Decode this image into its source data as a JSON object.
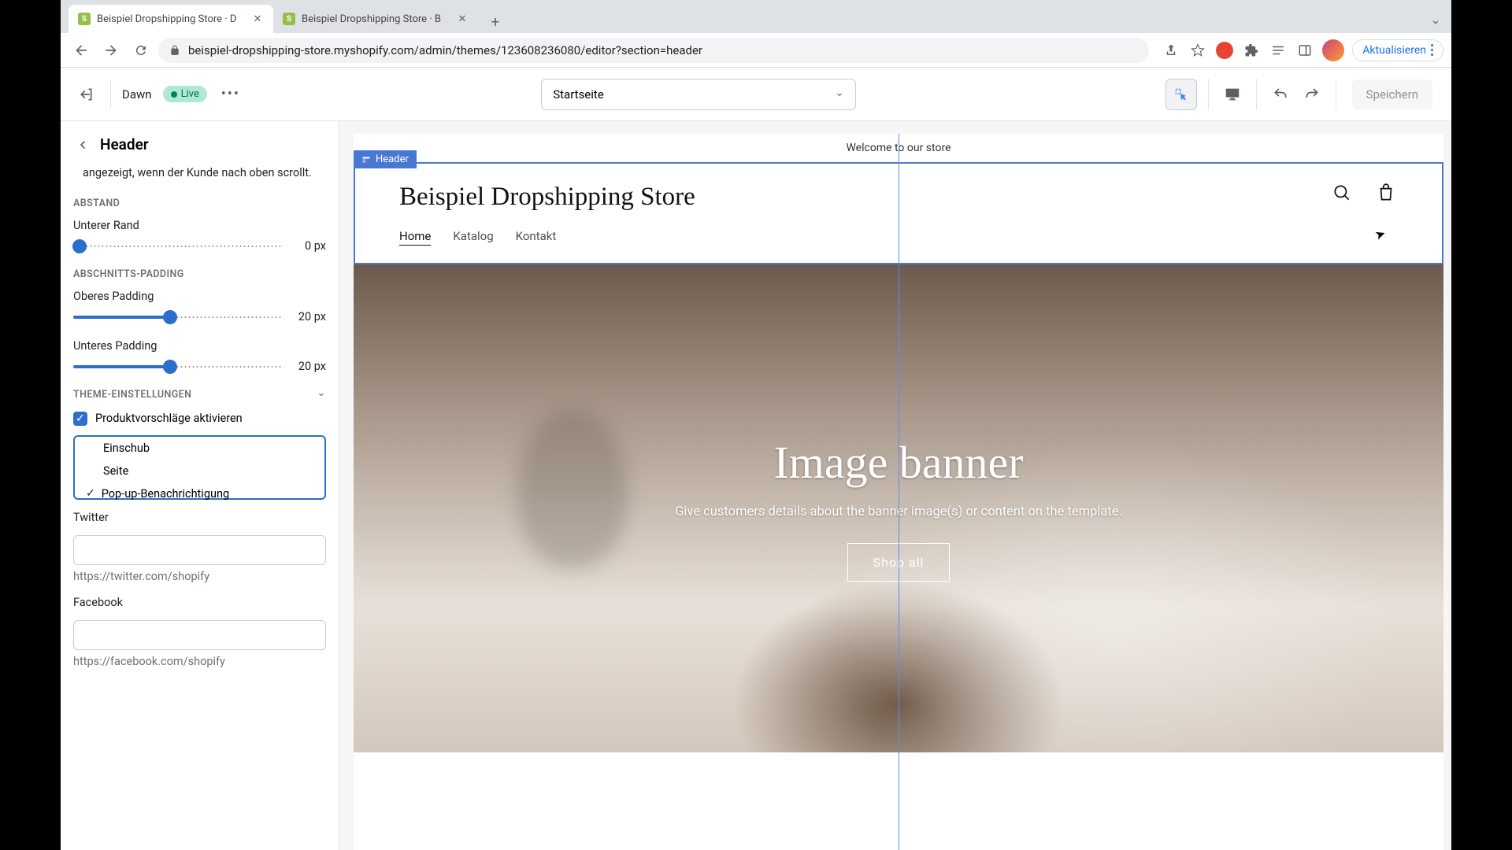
{
  "browser": {
    "tab1": "Beispiel Dropshipping Store · D",
    "tab2": "Beispiel Dropshipping Store · B",
    "url": "beispiel-dropshipping-store.myshopify.com/admin/themes/123608236080/editor?section=header",
    "update": "Aktualisieren"
  },
  "topbar": {
    "theme": "Dawn",
    "live": "Live",
    "page_select": "Startseite",
    "save": "Speichern"
  },
  "sidebar": {
    "title": "Header",
    "desc_tail": "angezeigt, wenn der Kunde nach oben scrollt.",
    "sections": {
      "abstand": "ABSTAND",
      "padding": "ABSCHNITTS-PADDING",
      "theme": "THEME-EINSTELLUNGEN"
    },
    "fields": {
      "unterer_rand": "Unterer Rand",
      "unterer_rand_val": "0 px",
      "oberes_padding": "Oberes Padding",
      "oberes_padding_val": "20 px",
      "unteres_padding": "Unteres Padding",
      "unteres_padding_val": "20 px",
      "checkbox": "Produktvorschläge aktivieren",
      "seg1": "Einschub",
      "seg2": "Seite",
      "seg3": "Pop-up-Benachrichtigung",
      "twitter": "Twitter",
      "twitter_hint": "https://twitter.com/shopify",
      "facebook": "Facebook",
      "facebook_hint": "https://facebook.com/shopify"
    }
  },
  "preview": {
    "header_label": "Header",
    "announce": "Welcome to our store",
    "store_name": "Beispiel Dropshipping Store",
    "nav": {
      "home": "Home",
      "katalog": "Katalog",
      "kontakt": "Kontakt"
    },
    "banner": {
      "title": "Image banner",
      "sub": "Give customers details about the banner image(s) or content on the template.",
      "btn": "Shop all"
    }
  }
}
